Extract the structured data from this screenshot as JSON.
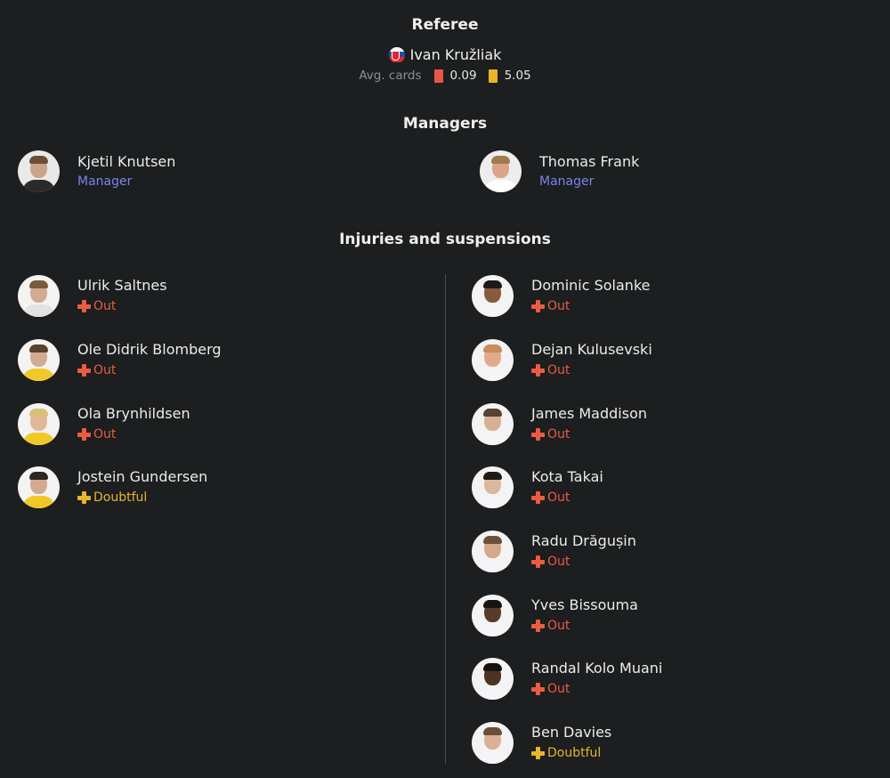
{
  "referee": {
    "title": "Referee",
    "name": "Ivan Kružliak",
    "flag_icon": "slovakia-flag-icon",
    "avg_cards_label": "Avg. cards",
    "red_avg": "0.09",
    "yellow_avg": "5.05",
    "red_color": "#e4584a",
    "yellow_color": "#e9b527"
  },
  "managers": {
    "title": "Managers",
    "home": {
      "name": "Kjetil Knutsen",
      "role": "Manager"
    },
    "away": {
      "name": "Thomas Frank",
      "role": "Manager"
    }
  },
  "injuries": {
    "title": "Injuries and suspensions",
    "status_colors": {
      "Out": "#ea5c44",
      "Doubtful": "#e8b52f"
    },
    "home": [
      {
        "name": "Ulrik Saltnes",
        "status": "Out"
      },
      {
        "name": "Ole Didrik Blomberg",
        "status": "Out"
      },
      {
        "name": "Ola Brynhildsen",
        "status": "Out"
      },
      {
        "name": "Jostein Gundersen",
        "status": "Doubtful"
      }
    ],
    "away": [
      {
        "name": "Dominic Solanke",
        "status": "Out"
      },
      {
        "name": "Dejan Kulusevski",
        "status": "Out"
      },
      {
        "name": "James Maddison",
        "status": "Out"
      },
      {
        "name": "Kota Takai",
        "status": "Out"
      },
      {
        "name": "Radu Drăgușin",
        "status": "Out"
      },
      {
        "name": "Yves Bissouma",
        "status": "Out"
      },
      {
        "name": "Randal Kolo Muani",
        "status": "Out"
      },
      {
        "name": "Ben Davies",
        "status": "Doubtful"
      }
    ]
  }
}
